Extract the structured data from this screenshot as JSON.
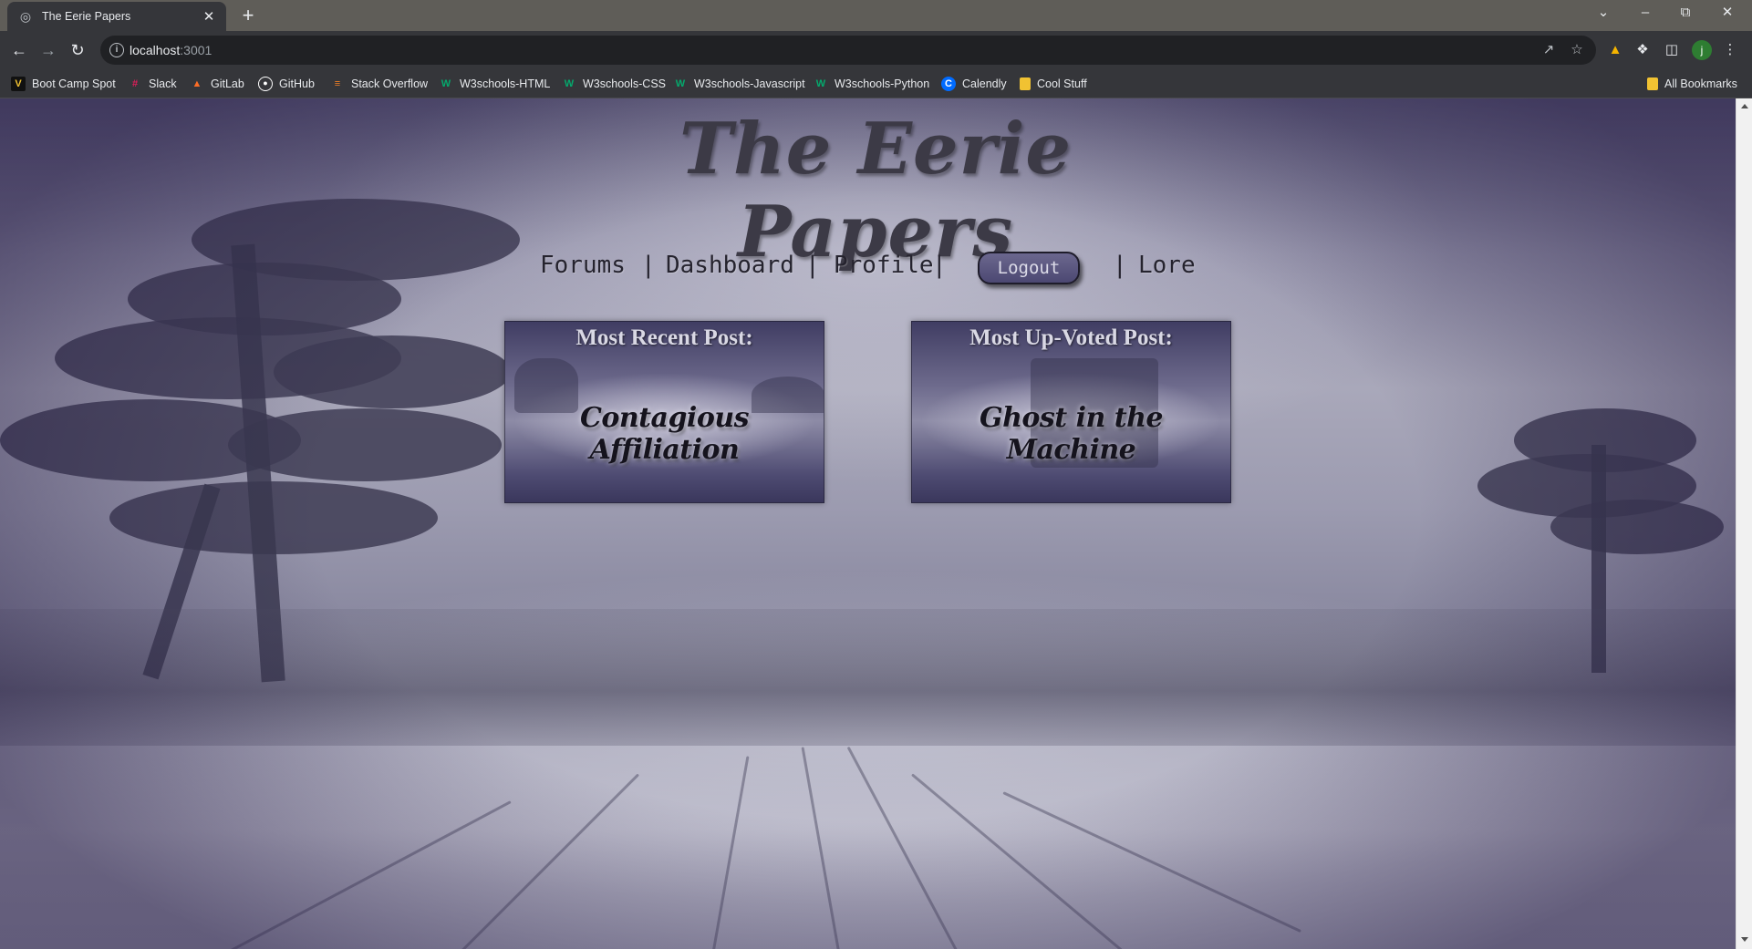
{
  "browser": {
    "tab_title": "The Eerie Papers",
    "url_host": "localhost",
    "url_port": ":3001",
    "profile_initial": "j",
    "bookmarks": [
      {
        "label": "Boot Camp Spot",
        "icon": "bootcamp-icon"
      },
      {
        "label": "Slack",
        "icon": "slack-icon"
      },
      {
        "label": "GitLab",
        "icon": "gitlab-icon"
      },
      {
        "label": "GitHub",
        "icon": "github-icon"
      },
      {
        "label": "Stack Overflow",
        "icon": "stackoverflow-icon"
      },
      {
        "label": "W3schools-HTML",
        "icon": "w3schools-icon"
      },
      {
        "label": "W3schools-CSS",
        "icon": "w3schools-icon"
      },
      {
        "label": "W3schools-Javascript",
        "icon": "w3schools-icon"
      },
      {
        "label": "W3schools-Python",
        "icon": "w3schools-icon"
      },
      {
        "label": "Calendly",
        "icon": "calendly-icon"
      },
      {
        "label": "Cool Stuff",
        "icon": "folder-icon"
      }
    ],
    "all_bookmarks_label": "All Bookmarks"
  },
  "page": {
    "site_title": "The Eerie Papers",
    "nav": {
      "forums": "Forums",
      "dashboard": "Dashboard",
      "profile": "Profile",
      "logout": "Logout",
      "lore": "Lore",
      "separator": "|"
    },
    "cards": [
      {
        "heading": "Most Recent Post:",
        "post_title": "Contagious Affiliation"
      },
      {
        "heading": "Most Up-Voted Post:",
        "post_title": "Ghost in the Machine"
      }
    ]
  },
  "colors": {
    "accent_button": "#5a5680",
    "title_ink": "#3c3a46",
    "chrome_dark": "#35363a"
  }
}
